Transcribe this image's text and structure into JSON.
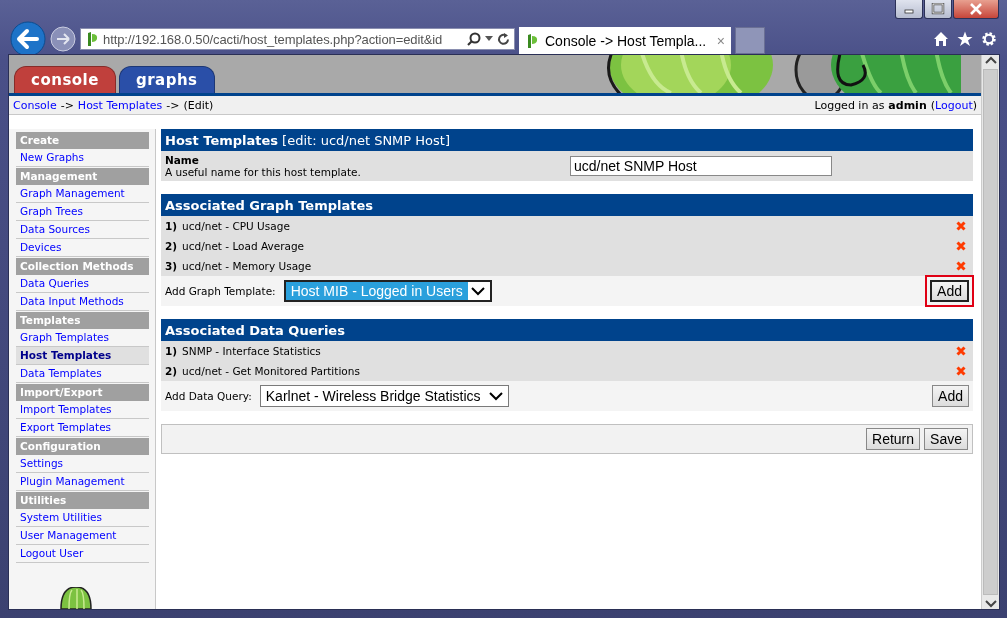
{
  "browser": {
    "url": "http://192.168.0.50/cacti/host_templates.php?action=edit&id",
    "tab_title": "Console -> Host Templa...",
    "tab_close": "×"
  },
  "header_tabs": [
    {
      "label": "console",
      "color": "#c0403c"
    },
    {
      "label": "graphs",
      "color": "#2a4fa8"
    }
  ],
  "breadcrumb": [
    {
      "kind": "link",
      "text": "Console"
    },
    {
      "kind": "text",
      "text": "->"
    },
    {
      "kind": "link",
      "text": "Host Templates"
    },
    {
      "kind": "text",
      "text": "->"
    },
    {
      "kind": "text",
      "text": "(Edit)"
    }
  ],
  "login": [
    {
      "kind": "text",
      "text": "Logged in as"
    },
    {
      "kind": "bold",
      "text": "admin"
    },
    {
      "kind": "text",
      "text": "("
    },
    {
      "kind": "link",
      "text": "Logout"
    },
    {
      "kind": "text",
      "text": ")"
    }
  ],
  "sidebar": {
    "sections": [
      {
        "title": "Create",
        "items": [
          {
            "label": "New Graphs",
            "selected": false
          }
        ]
      },
      {
        "title": "Management",
        "items": [
          {
            "label": "Graph Management",
            "selected": false
          },
          {
            "label": "Graph Trees",
            "selected": false
          },
          {
            "label": "Data Sources",
            "selected": false
          },
          {
            "label": "Devices",
            "selected": false
          }
        ]
      },
      {
        "title": "Collection Methods",
        "items": [
          {
            "label": "Data Queries",
            "selected": false
          },
          {
            "label": "Data Input Methods",
            "selected": false
          }
        ]
      },
      {
        "title": "Templates",
        "items": [
          {
            "label": "Graph Templates",
            "selected": false
          },
          {
            "label": "Host Templates",
            "selected": true
          },
          {
            "label": "Data Templates",
            "selected": false
          }
        ]
      },
      {
        "title": "Import/Export",
        "items": [
          {
            "label": "Import Templates",
            "selected": false
          },
          {
            "label": "Export Templates",
            "selected": false
          }
        ]
      },
      {
        "title": "Configuration",
        "items": [
          {
            "label": "Settings",
            "selected": false
          },
          {
            "label": "Plugin Management",
            "selected": false
          }
        ]
      },
      {
        "title": "Utilities",
        "items": [
          {
            "label": "System Utilities",
            "selected": false
          },
          {
            "label": "User Management",
            "selected": false
          },
          {
            "label": "Logout User",
            "selected": false
          }
        ]
      }
    ]
  },
  "template_form": {
    "title": "Host Templates",
    "subtitle": "[edit: ucd/net SNMP Host]",
    "field_label": "Name",
    "field_description": "A useful name for this host template.",
    "field_value": "ucd/net SNMP Host"
  },
  "graph_templates": {
    "title": "Associated Graph Templates",
    "items": [
      {
        "number": "1)",
        "name": "ucd/net - CPU Usage"
      },
      {
        "number": "2)",
        "name": "ucd/net - Load Average"
      },
      {
        "number": "3)",
        "name": "ucd/net - Memory Usage"
      }
    ],
    "add_label": "Add Graph Template:",
    "select_value": "Host MIB - Logged in Users",
    "select_focused": true,
    "add_button": "Add",
    "add_button_highlighted": true
  },
  "data_queries": {
    "title": "Associated Data Queries",
    "items": [
      {
        "number": "1)",
        "name": "SNMP - Interface Statistics"
      },
      {
        "number": "2)",
        "name": "ucd/net - Get Monitored Partitions"
      }
    ],
    "add_label": "Add Data Query:",
    "select_value": "Karlnet - Wireless Bridge Statistics",
    "select_focused": false,
    "add_button": "Add",
    "add_button_highlighted": false
  },
  "footer_buttons": [
    "Return",
    "Save"
  ]
}
